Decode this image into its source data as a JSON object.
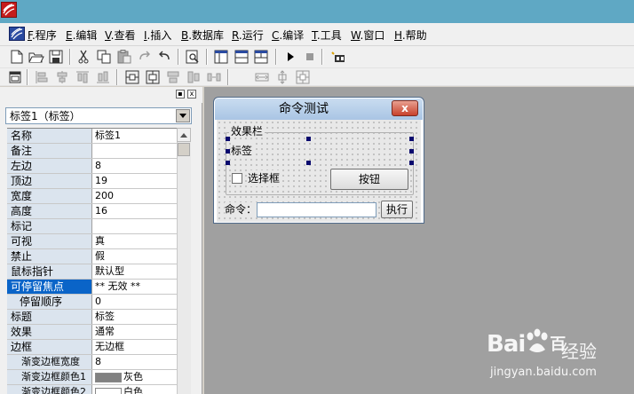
{
  "menu": {
    "items": [
      {
        "key": "F",
        "label": ".程序"
      },
      {
        "key": "E",
        "label": ".编辑"
      },
      {
        "key": "V",
        "label": ".查看"
      },
      {
        "key": "I",
        "label": ".插入"
      },
      {
        "key": "B",
        "label": ".数据库"
      },
      {
        "key": "R",
        "label": ".运行"
      },
      {
        "key": "C",
        "label": ".编译"
      },
      {
        "key": "T",
        "label": ".工具"
      },
      {
        "key": "W",
        "label": ".窗口"
      },
      {
        "key": "H",
        "label": ".帮助"
      }
    ]
  },
  "toolbar1": {
    "icons": [
      "new-file-icon",
      "open-folder-icon",
      "save-icon",
      "cut-icon",
      "copy-icon",
      "paste-icon",
      "redo-icon",
      "undo-icon",
      "find-icon",
      "layout-1-icon",
      "layout-2-icon",
      "layout-3-icon",
      "run-icon",
      "stop-icon",
      "debug-icon"
    ]
  },
  "toolbar2": {
    "icons": [
      "form-icon",
      "align-left-icon",
      "align-center-v-icon",
      "align-top-icon",
      "align-bottom-icon",
      "center-h-icon",
      "center-v-icon",
      "same-width-icon",
      "same-height-icon",
      "space-h-icon",
      "space-v-icon",
      "grid-icon"
    ]
  },
  "panel": {
    "combo_value": "标签1（标签）",
    "pin_label": "▪",
    "close_label": "x"
  },
  "properties": [
    {
      "name": "名称",
      "value": "标签1"
    },
    {
      "name": "备注",
      "value": ""
    },
    {
      "name": "左边",
      "value": "8"
    },
    {
      "name": "顶边",
      "value": "19"
    },
    {
      "name": "宽度",
      "value": "200"
    },
    {
      "name": "高度",
      "value": "16"
    },
    {
      "name": "标记",
      "value": ""
    },
    {
      "name": "可视",
      "value": "真"
    },
    {
      "name": "禁止",
      "value": "假"
    },
    {
      "name": "鼠标指针",
      "value": "默认型"
    },
    {
      "name": "可停留焦点",
      "value": "** 无效 **",
      "selected": true
    },
    {
      "name": "停留顺序",
      "value": "0",
      "indent": true
    },
    {
      "name": "标题",
      "value": "标签"
    },
    {
      "name": "效果",
      "value": "通常"
    },
    {
      "name": "边框",
      "value": "无边框"
    },
    {
      "name": "渐变边框宽度",
      "value": "8",
      "indent2": true
    },
    {
      "name": "渐变边框颜色1",
      "value": "灰色",
      "indent2": true,
      "swatch": "#808080"
    },
    {
      "name": "渐变边框颜色2",
      "value": "白色",
      "indent2": true,
      "swatch": "#ffffff"
    }
  ],
  "form": {
    "title": "命令测试",
    "close_glyph": "x",
    "group_label": "效果栏",
    "label_text": "标签",
    "checkbox_label": "选择框",
    "checkbox_checked": false,
    "button_label": "按钮",
    "command_label": "命令：",
    "command_value": "",
    "exec_label": "执行"
  },
  "watermark": {
    "logo": "Bai",
    "logo_suffix": "百",
    "cn": "经验",
    "url": "jingyan.baidu.com"
  }
}
